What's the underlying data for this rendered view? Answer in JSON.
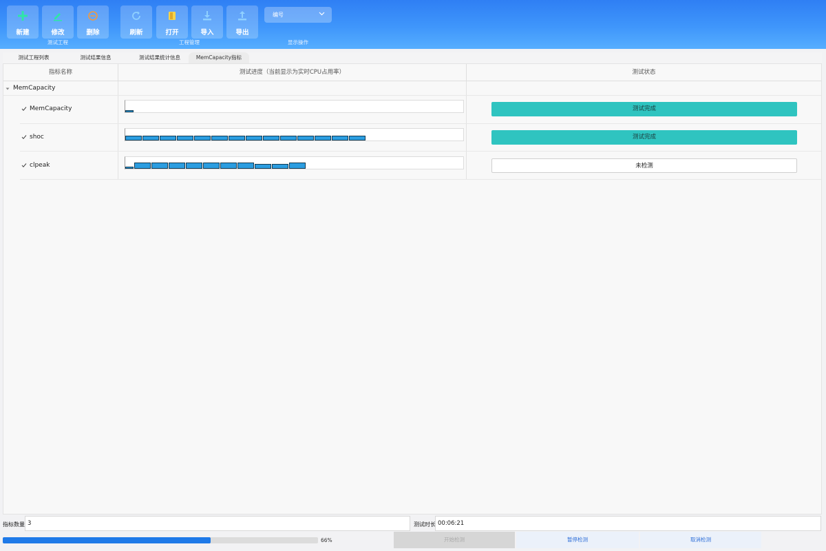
{
  "toolbar": {
    "buttons": [
      {
        "label": "新建",
        "icon": "plus-icon"
      },
      {
        "label": "修改",
        "icon": "edit-icon"
      },
      {
        "label": "删除",
        "icon": "remove-icon"
      },
      {
        "label": "刷新",
        "icon": "refresh-icon"
      },
      {
        "label": "打开",
        "icon": "folder-open-icon"
      },
      {
        "label": "导入",
        "icon": "import-icon"
      },
      {
        "label": "导出",
        "icon": "export-icon"
      }
    ],
    "groups": [
      "测试工程",
      "工程管理",
      "显示操作"
    ],
    "combo_value": "编号",
    "colors": {
      "accent": "#3f96fb",
      "icon_green": "#2ee6a6",
      "icon_yellow": "#f7d44a",
      "icon_orange": "#f49a3c"
    }
  },
  "tabs": [
    {
      "label": "测试工程列表"
    },
    {
      "label": "测试结果信息"
    },
    {
      "label": "测试结果统计信息"
    },
    {
      "label": "MemCapacity指标",
      "active": true
    }
  ],
  "table": {
    "headers": [
      "指标名称",
      "测试进度（当前显示为实时CPU占用率）",
      "测试状态"
    ],
    "group": "MemCapacity",
    "rows": [
      {
        "name": "MemCapacity",
        "status": "测试完成",
        "state": "done",
        "bars": [
          0.15
        ]
      },
      {
        "name": "shoc",
        "status": "测试完成",
        "state": "done",
        "bars": [
          0.4,
          0.4,
          0.4,
          0.4,
          0.4,
          0.4,
          0.4,
          0.4,
          0.4,
          0.4,
          0.4,
          0.4,
          0.4,
          0.4
        ]
      },
      {
        "name": "clpeak",
        "status": "未检测",
        "state": "none",
        "bars": [
          0.15,
          0.55,
          0.55,
          0.55,
          0.55,
          0.55,
          0.55,
          0.55,
          0.4,
          0.4,
          0.55
        ]
      }
    ],
    "colors": {
      "done": "#2fc4c0",
      "bar": "#2b9de0"
    }
  },
  "bottom": {
    "count_label": "指标数量",
    "count_value": "3",
    "duration_label": "测试时长",
    "duration_value": "00:06:21",
    "progress": 0.66,
    "progress_text": "66%",
    "start_label": "开始检测",
    "pause_label": "暂停检测",
    "cancel_label": "取消检测"
  }
}
